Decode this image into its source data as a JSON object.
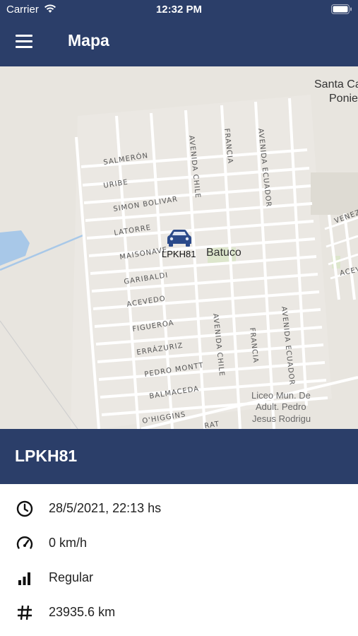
{
  "status_bar": {
    "carrier": "Carrier",
    "time": "12:32 PM",
    "icons": [
      "wifi-icon",
      "battery-icon"
    ]
  },
  "navbar": {
    "title": "Mapa",
    "menu_icon": "menu-icon"
  },
  "map": {
    "streets": [
      "SALMERÓN",
      "URIBE",
      "SIMON BOLIVAR",
      "LATORRE",
      "MAISONAVE",
      "GARIBALDI",
      "ACEVEDO",
      "FIGUEROA",
      "ERRÁZURIZ",
      "PEDRO MONTT",
      "BALMACEDA",
      "O'HIGGINS",
      "AVENIDA CHILE",
      "FRANCIA",
      "AVENIDA ECUADOR",
      "AVENIDA CHILE",
      "FRANCIA",
      "AVENIDA ECUADOR",
      "VENEZ",
      "ACEV",
      "RAT"
    ],
    "place_label": "Batuco",
    "place_top_right": [
      "Santa Ca",
      "Ponie"
    ],
    "poi": [
      "Liceo Mun. De",
      "Adult. Pedro",
      "Jesus Rodrigu"
    ],
    "vehicle_marker": {
      "icon": "car-icon",
      "label": "LPKH81",
      "color": "#2b4a8a"
    }
  },
  "vehicle": {
    "plate": "LPKH81",
    "details": [
      {
        "icon": "clock-icon",
        "text": "28/5/2021, 22:13 hs"
      },
      {
        "icon": "speedometer-icon",
        "text": "0 km/h"
      },
      {
        "icon": "signal-bars-icon",
        "text": "Regular"
      },
      {
        "icon": "hash-icon",
        "text": "23935.6 km"
      }
    ]
  },
  "colors": {
    "primary": "#2b3e69",
    "map_background": "#e8e5df",
    "water": "#a8c8e8",
    "park": "#d9e8c8"
  }
}
